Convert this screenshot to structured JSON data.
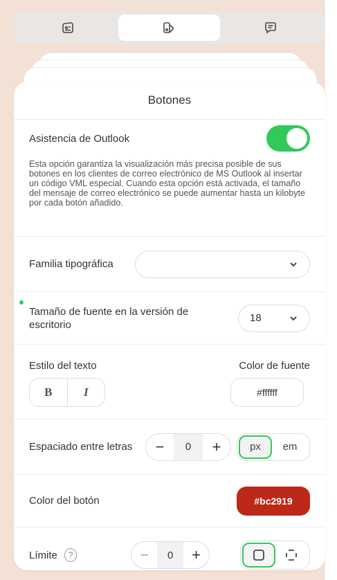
{
  "tabs": [
    {
      "icon": "content-card-icon",
      "active": false
    },
    {
      "icon": "style-palette-icon",
      "active": true
    },
    {
      "icon": "chat-message-icon",
      "active": false
    }
  ],
  "panel": {
    "title": "Botones",
    "outlook": {
      "label": "Asistencia de Outlook",
      "enabled": true,
      "description": "Esta opción garantiza la visualización más precisa posible de sus botones en los clientes de correo electrónico de MS Outlook al insertar un código VML especial. Cuando esta opción está activada, el tamaño del mensaje de correo electrónico se puede aumentar hasta un kilobyte por cada botón añadido."
    },
    "font_family": {
      "label": "Familia tipográfica",
      "value": ""
    },
    "font_size": {
      "label": "Tamaño de fuente en la versión de escritorio",
      "value": "18"
    },
    "text_style": {
      "label": "Estilo del texto",
      "bold": "B",
      "italic": "I"
    },
    "font_color": {
      "label": "Color de fuente",
      "value": "#ffffff"
    },
    "letter_spacing": {
      "label": "Espaciado entre letras",
      "minus": "−",
      "value": "0",
      "plus": "+",
      "unit_px": "px",
      "unit_em": "em",
      "active_unit": "px"
    },
    "button_color": {
      "label": "Color del botón",
      "value": "#bc2919",
      "color": "#bc2919"
    },
    "border": {
      "label": "Límite",
      "help": "?",
      "minus": "−",
      "value": "0",
      "plus": "+"
    }
  },
  "colors": {
    "accent": "#33c95a",
    "background": "#f3e1d6"
  }
}
